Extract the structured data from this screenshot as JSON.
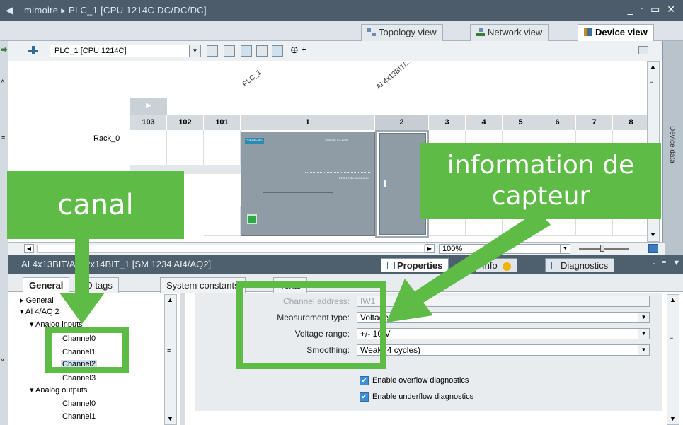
{
  "titlebar": {
    "breadcrumb": "mimoire  ▸  PLC_1 [CPU 1214C DC/DC/DC]",
    "window_controls": "_ ▫ ▭ ✕"
  },
  "view_tabs": [
    "Topology view",
    "Network view",
    "Device view"
  ],
  "device_selector": {
    "value": "PLC_1 [CPU 1214C]"
  },
  "canvas": {
    "device_label_plc": "PLC_1",
    "device_label_module": "AI 4x13BIT/...",
    "rack_label": "Rack_0",
    "slots": [
      "103",
      "102",
      "101",
      "1",
      "2",
      "3",
      "4",
      "5",
      "6",
      "7",
      "8"
    ],
    "cpu_brand": "SIEMENS",
    "cpu_model": "SIMATIC S7-1200",
    "cpu_type_text": "CPU 1214C DC/DC/DC",
    "zoom": "100%"
  },
  "device_data_tab": "Device data",
  "properties": {
    "module_title": "AI 4x13BIT/AQ 2x14BIT_1 [SM 1234 AI4/AQ2]",
    "tabs": [
      "Properties",
      "Info",
      "Diagnostics"
    ],
    "subtabs": [
      "General",
      "IO tags",
      "System constants",
      "Texts"
    ],
    "tree": [
      {
        "label": "General",
        "level": 0,
        "arrow": "▸"
      },
      {
        "label": "AI 4/AQ 2",
        "level": 0,
        "arrow": "▾"
      },
      {
        "label": "Analog inputs",
        "level": 1,
        "arrow": "▾"
      },
      {
        "label": "Channel0",
        "level": 2,
        "arrow": ""
      },
      {
        "label": "Channel1",
        "level": 2,
        "arrow": ""
      },
      {
        "label": "Channel2",
        "level": 2,
        "arrow": "",
        "selected": true
      },
      {
        "label": "Channel3",
        "level": 2,
        "arrow": ""
      },
      {
        "label": "Analog outputs",
        "level": 1,
        "arrow": "▾"
      },
      {
        "label": "Channel0",
        "level": 2,
        "arrow": ""
      },
      {
        "label": "Channel1",
        "level": 2,
        "arrow": ""
      }
    ],
    "form": {
      "channel_address_label": "Channel address:",
      "channel_address_value": "IW1",
      "measurement_type_label": "Measurement type:",
      "measurement_type_value": "Voltage",
      "voltage_range_label": "Voltage range:",
      "voltage_range_value": "+/- 10 V",
      "smoothing_label": "Smoothing:",
      "smoothing_value": "Weak (4 cycles)",
      "overflow_label": "Enable overflow diagnostics",
      "underflow_label": "Enable underflow diagnostics"
    }
  },
  "annotations": {
    "canal": "canal",
    "info_line1": "information de",
    "info_line2": "capteur",
    "accent": "#5dbb46"
  }
}
